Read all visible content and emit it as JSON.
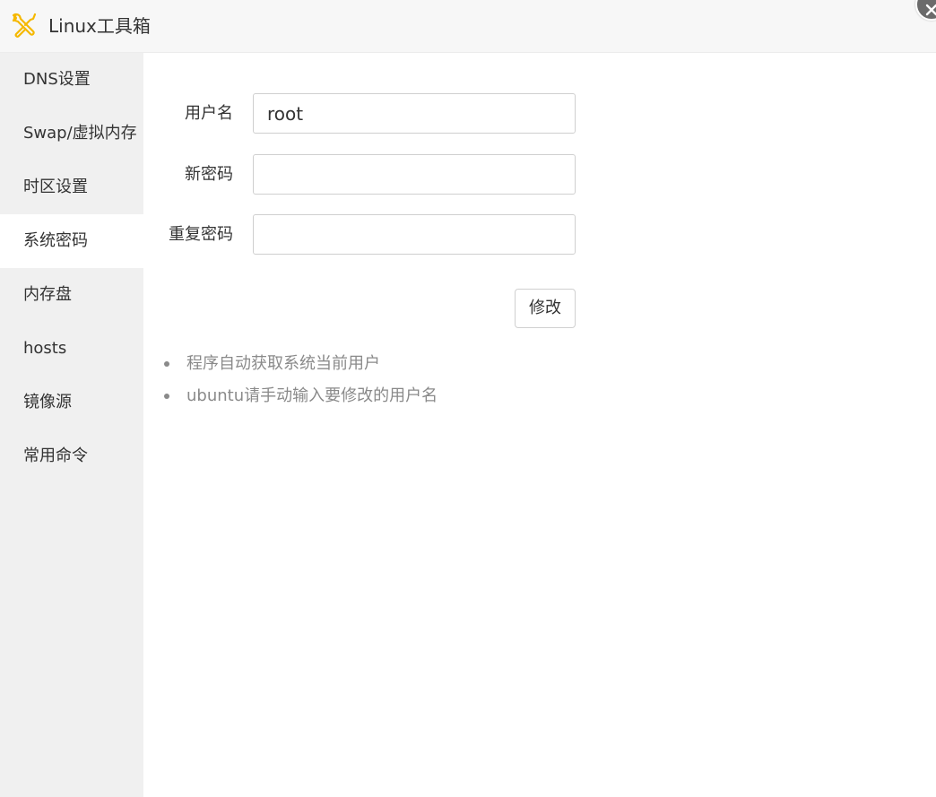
{
  "app": {
    "title": "Linux工具箱",
    "icon": "tools-icon",
    "accent_color": "#f5b800"
  },
  "sidebar": {
    "active_index": 3,
    "items": [
      {
        "label": "DNS设置"
      },
      {
        "label": "Swap/虚拟内存"
      },
      {
        "label": "时区设置"
      },
      {
        "label": "系统密码"
      },
      {
        "label": "内存盘"
      },
      {
        "label": "hosts"
      },
      {
        "label": "镜像源"
      },
      {
        "label": "常用命令"
      }
    ]
  },
  "form": {
    "username": {
      "label": "用户名",
      "value": "root"
    },
    "new_password": {
      "label": "新密码",
      "value": ""
    },
    "repeat_password": {
      "label": "重复密码",
      "value": ""
    },
    "submit_label": "修改"
  },
  "tips": [
    "程序自动获取系统当前用户",
    "ubuntu请手动输入要修改的用户名"
  ]
}
